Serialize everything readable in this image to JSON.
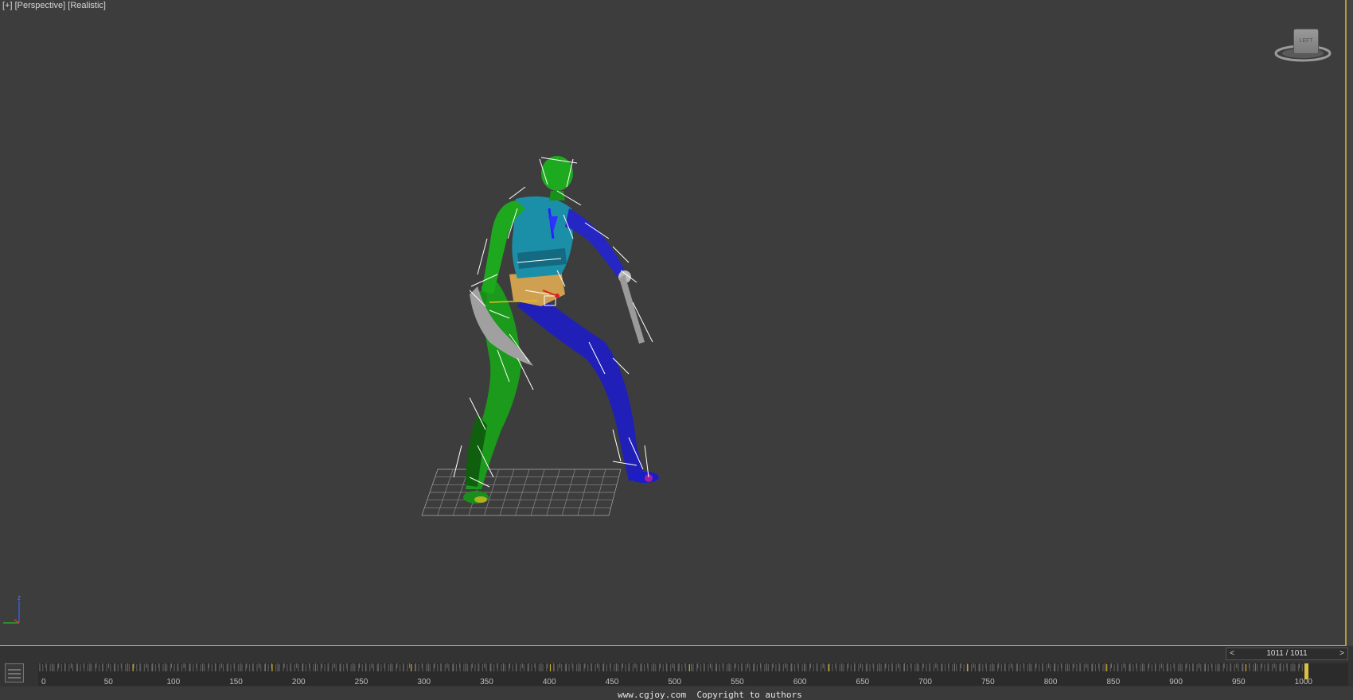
{
  "viewport": {
    "menu_label": "[+]",
    "view_label": "[Perspective]",
    "shading_label": "[Realistic]"
  },
  "viewcube": {
    "face_label": "LEFT"
  },
  "axis_tripod": {
    "z_label": "z",
    "x_label": "x",
    "y_label": "y"
  },
  "time_slider": {
    "counter": "1011 / 1011",
    "prev": "<",
    "next": ">",
    "current_frame": 1011,
    "total_frames": 1011
  },
  "trackbar": {
    "start": 0,
    "end": 1011,
    "tick_labels": [
      "0",
      "50",
      "100",
      "150",
      "200",
      "250",
      "300",
      "350",
      "400",
      "450",
      "500",
      "550",
      "600",
      "650",
      "700",
      "750",
      "800",
      "850",
      "900",
      "950",
      "1000"
    ]
  },
  "watermark": "www.cgjoy.com  Copyright to authors",
  "colors": {
    "viewport_bg": "#3d3d3d",
    "active_border": "#b89a3a",
    "left_side": "#1fa21f",
    "right_side": "#2a2ad6",
    "spine": "#1aa3b5",
    "weapon": "#9c9c9c"
  }
}
